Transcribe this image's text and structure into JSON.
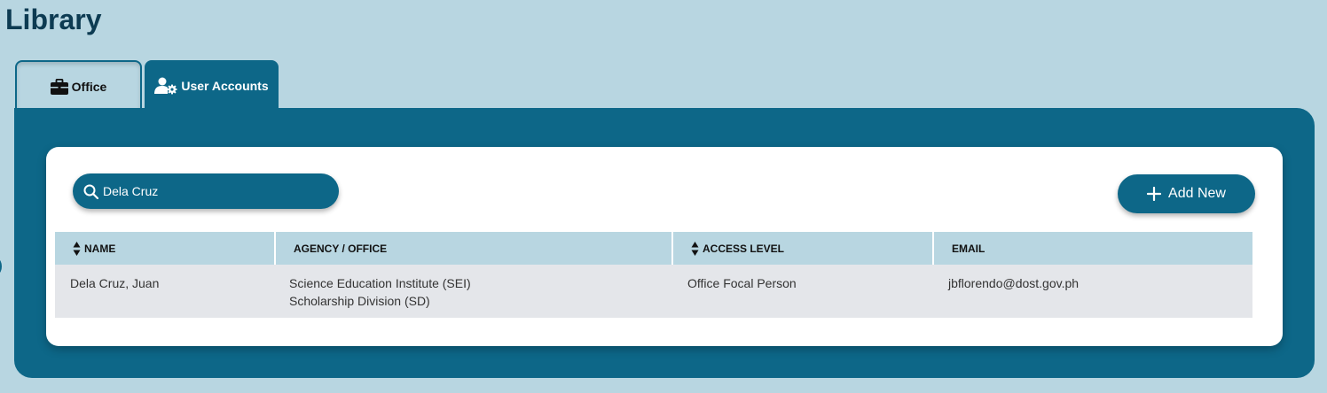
{
  "page": {
    "title": "Library"
  },
  "tabs": [
    {
      "label": "Office",
      "icon": "briefcase-icon",
      "active": false
    },
    {
      "label": "User Accounts",
      "icon": "user-gear-icon",
      "active": true
    }
  ],
  "toolbar": {
    "search_value": "Dela Cruz",
    "add_label": "Add New"
  },
  "table": {
    "columns": [
      {
        "label": "NAME",
        "sortable": true
      },
      {
        "label": "AGENCY / OFFICE",
        "sortable": false
      },
      {
        "label": "ACCESS LEVEL",
        "sortable": true
      },
      {
        "label": "EMAIL",
        "sortable": false
      }
    ],
    "rows": [
      {
        "name": "Dela Cruz, Juan",
        "agency": "Science Education Institute (SEI)",
        "office": "Scholarship Division (SD)",
        "access_level": "Office Focal Person",
        "email": "jbflorendo@dost.gov.ph"
      }
    ]
  },
  "colors": {
    "background": "#b8d6e1",
    "primary": "#0d6788",
    "title": "#0d3b52",
    "row": "#e4e6ea"
  }
}
